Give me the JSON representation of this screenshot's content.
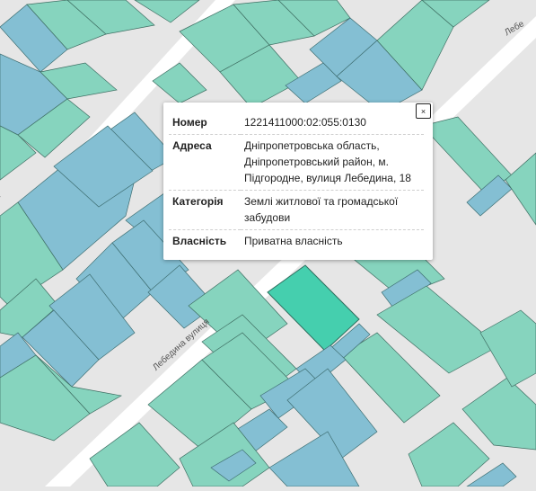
{
  "map": {
    "street_label": "Лебедина вулиця",
    "colors": {
      "private": "#86d4be",
      "other": "#84bfd3",
      "selected": "#45cfae",
      "road": "#ffffff",
      "background": "#e6e6e6"
    }
  },
  "popup": {
    "close_label": "×",
    "rows": [
      {
        "key": "Номер",
        "value": "1221411000:02:055:0130"
      },
      {
        "key": "Адреса",
        "value": "Дніпропетровська область, Дніпропетровський район, м. Підгородне, вулиця Лебедина, 18"
      },
      {
        "key": "Категорія",
        "value": "Землі житлової та громадської забудови"
      },
      {
        "key": "Власність",
        "value": "Приватна власність"
      }
    ]
  }
}
